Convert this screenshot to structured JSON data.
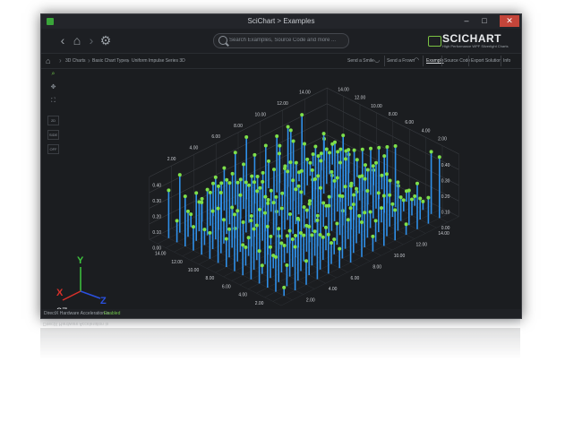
{
  "window": {
    "title": "SciChart > Examples"
  },
  "titlebar": {
    "minimize": "–",
    "maximize": "□",
    "close": "✕"
  },
  "navbar": {
    "back_icon": "chevron-left-icon",
    "home_icon": "home-icon",
    "forward_icon": "chevron-right-icon",
    "settings_icon": "gear-icon",
    "search_placeholder": "Search Examples, Source Code and more ..."
  },
  "logo": {
    "brand": "SCICHART",
    "tagline": "High Performance WPF Silverlight Charts"
  },
  "breadcrumb": {
    "items": [
      "3D Charts",
      "Basic Chart Types",
      "Uniform Impulse Series 3D"
    ]
  },
  "actions": {
    "smile": "Send a Smile",
    "frown": "Send a Frown",
    "example": "Example",
    "source": "Source Code",
    "export": "Export Solution",
    "info": "Info"
  },
  "toolbar": {
    "b1": "2D",
    "b2": "SIDE",
    "b3": "OFF"
  },
  "chart_data": {
    "type": "impulse-3d",
    "title": "",
    "x_ticks": [
      "2.00",
      "4.00",
      "6.00",
      "8.00",
      "10.00",
      "12.00",
      "14.00"
    ],
    "z_ticks": [
      "2.00",
      "4.00",
      "6.00",
      "8.00",
      "10.00",
      "12.00",
      "14.00"
    ],
    "y_ticks": [
      "0.00",
      "0.10",
      "0.20",
      "0.30",
      "0.40"
    ],
    "grid_size": 15,
    "stem_color": "#2f8fe8",
    "marker_color": "#7ee04a",
    "axis_labels": {
      "x": "X",
      "y": "Y",
      "z": "Z"
    },
    "camera_value": "27"
  },
  "status": {
    "label": "DirectX Hardware Acceleration is",
    "value": "Enabled"
  }
}
